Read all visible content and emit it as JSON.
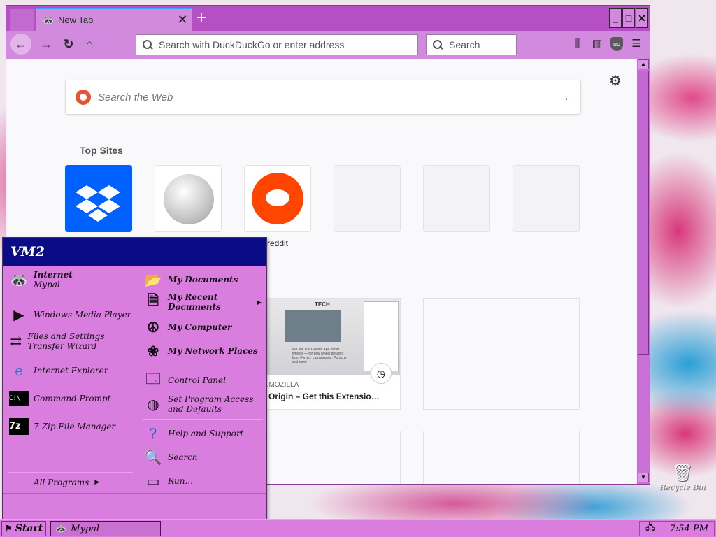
{
  "browser": {
    "tab_title": "New Tab",
    "new_tab_symbol": "+",
    "window_buttons": [
      "_",
      "□",
      "✕"
    ],
    "url_placeholder": "Search with DuckDuckGo or enter address",
    "search_placeholder": "Search",
    "web_search_placeholder": "Search the Web",
    "top_sites_title": "Top Sites",
    "top_sites": [
      {
        "name": "dropbox",
        "label": ""
      },
      {
        "name": "wikipedia",
        "label": ""
      },
      {
        "name": "reddit",
        "label": "reddit"
      }
    ],
    "highlight_card": {
      "source": "ONS.MOZILLA",
      "title": "ock Origin – Get this Extensio…",
      "thumb_tag": "TECH",
      "thumb_text": "We live in a Golden Age of car wheels — for new wheel designs from Ferrari, Lamborghini, Porsche and more"
    }
  },
  "start_menu": {
    "user": "VM2",
    "left_items": [
      {
        "title": "Internet",
        "subtitle": "Mypal",
        "icon": "raccoon-icon"
      },
      {
        "title": "Windows Media Player",
        "icon": "media-player-icon"
      },
      {
        "title": "Files and Settings Transfer Wizard",
        "icon": "transfer-wizard-icon"
      },
      {
        "title": "Internet Explorer",
        "icon": "internet-explorer-icon"
      },
      {
        "title": "Command Prompt",
        "icon": "command-prompt-icon"
      },
      {
        "title": "7-Zip File Manager",
        "icon": "7zip-icon"
      }
    ],
    "all_programs": "All Programs",
    "right_items": [
      {
        "title": "My Documents",
        "icon": "documents-folder-icon"
      },
      {
        "title": "My Recent Documents",
        "icon": "recent-documents-icon"
      },
      {
        "title": "My Computer",
        "icon": "computer-icon"
      },
      {
        "title": "My Network Places",
        "icon": "network-icon"
      },
      {
        "title": "Control Panel",
        "icon": "control-panel-icon"
      },
      {
        "title": "Set Program Access and Defaults",
        "icon": "program-access-icon"
      },
      {
        "title": "Help and Support",
        "icon": "help-icon"
      },
      {
        "title": "Search",
        "icon": "search-icon"
      },
      {
        "title": "Run...",
        "icon": "run-icon"
      }
    ]
  },
  "taskbar": {
    "start_label": "Start",
    "task_label": "Mypal",
    "clock": "7:54 PM"
  },
  "desktop": {
    "recycle_bin": "Recycle Bin"
  }
}
